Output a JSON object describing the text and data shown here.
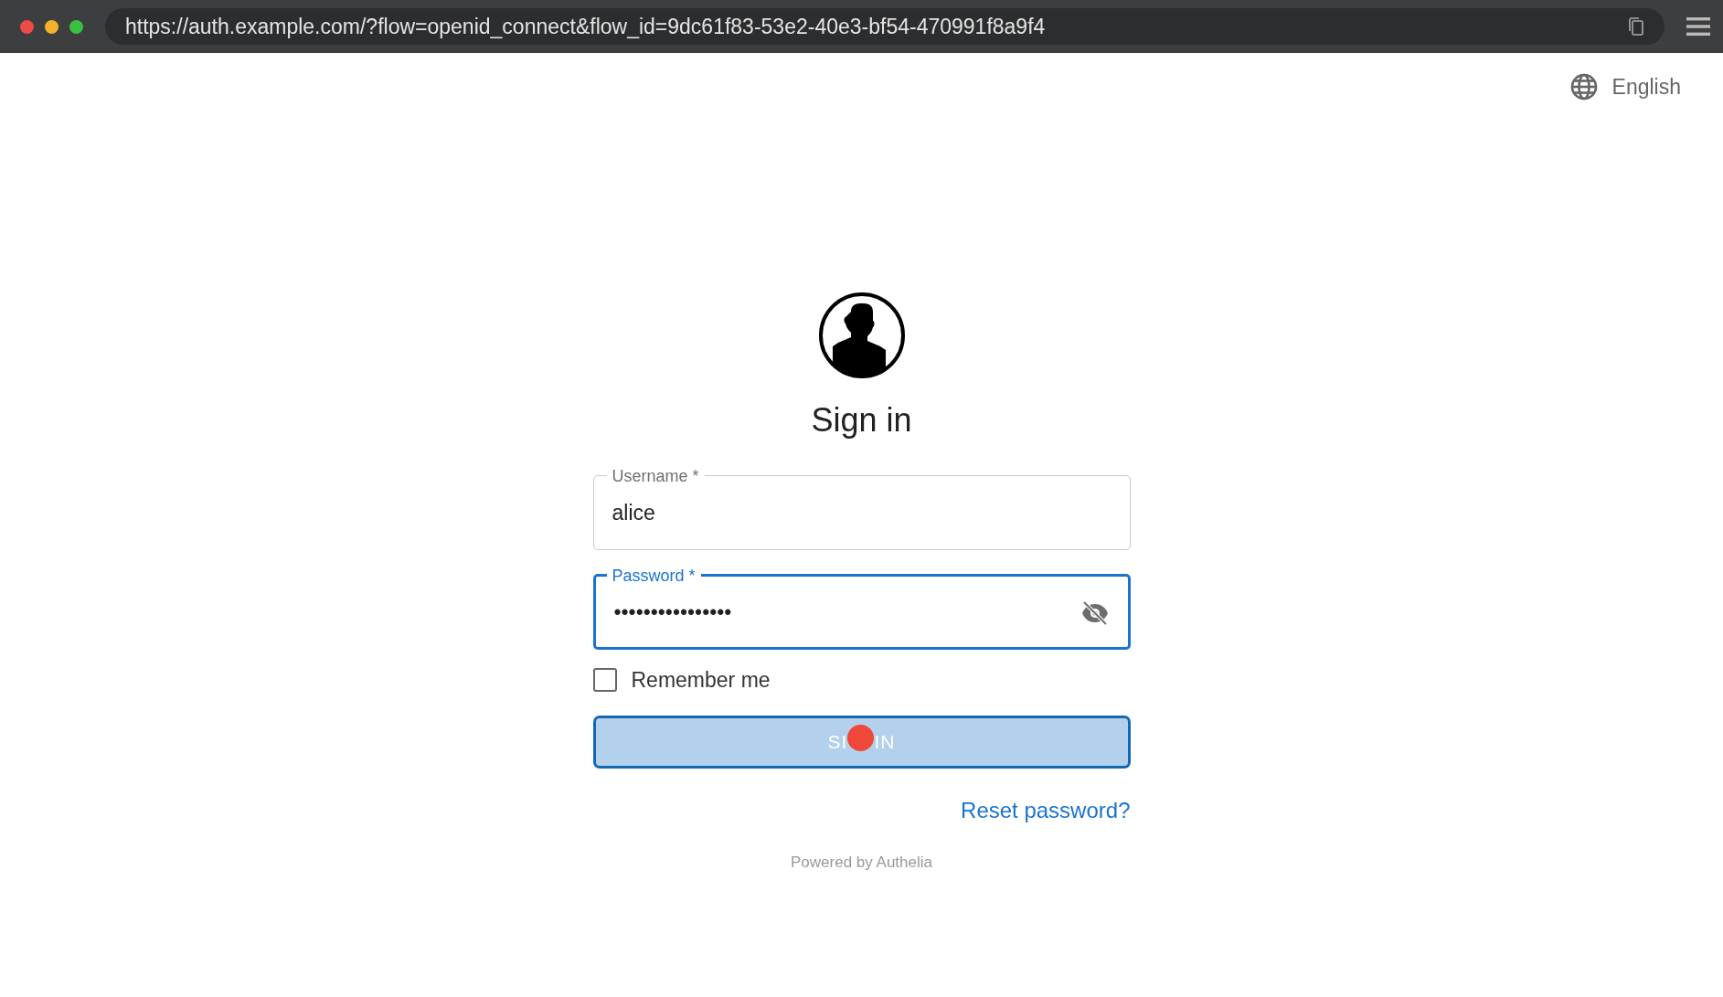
{
  "browser": {
    "url": "https://auth.example.com/?flow=openid_connect&flow_id=9dc61f83-53e2-40e3-bf54-470991f8a9f4"
  },
  "language": {
    "label": "English"
  },
  "title": "Sign in",
  "fields": [
    {
      "kind": "text",
      "label": "Username *",
      "value": "alice",
      "focused": false
    },
    {
      "kind": "password",
      "label": "Password *",
      "value": "••••••••••••••••",
      "focused": true
    }
  ],
  "remember": {
    "label": "Remember me",
    "checked": false
  },
  "submit": {
    "label_parts": [
      "SI",
      "IN"
    ],
    "disabled": true,
    "clicked": true
  },
  "reset_link": "Reset password?",
  "footer": "Powered by Authelia"
}
